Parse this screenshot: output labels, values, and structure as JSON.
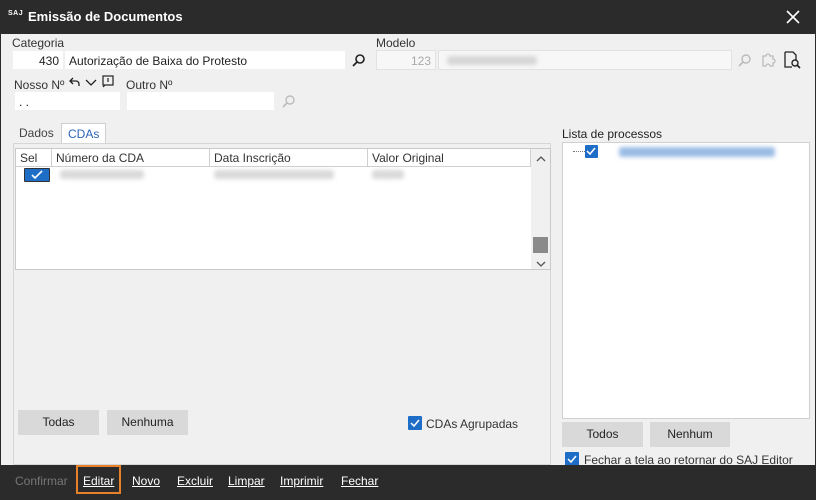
{
  "window": {
    "logo_text": "SAJ",
    "title": "Emissão de Documentos"
  },
  "header": {
    "categoria_label": "Categoria",
    "categoria_code": "430",
    "categoria_desc": "Autorização de Baixa do Protesto",
    "modelo_label": "Modelo",
    "modelo_code": "123",
    "nosso_no_label": "Nosso Nº",
    "nosso_no_value": " .  .",
    "outro_no_label": "Outro Nº",
    "outro_no_value": ""
  },
  "tabs": [
    {
      "label": "Dados",
      "active": false
    },
    {
      "label": "CDAs",
      "active": true
    }
  ],
  "grid": {
    "columns": [
      "Sel",
      "Número da CDA",
      "Data Inscrição",
      "Valor Original"
    ],
    "rows": [
      {
        "selected": true
      }
    ]
  },
  "left_buttons": {
    "todas": "Todas",
    "nenhuma": "Nenhuma",
    "cdas_agrupadas": "CDAs Agrupadas"
  },
  "processes": {
    "label": "Lista de processos",
    "todos": "Todos",
    "nenhum": "Nenhum",
    "fechar_label": "Fechar a tela ao retornar do SAJ Editor"
  },
  "footer": {
    "confirmar": "Confirmar",
    "editar": "Editar",
    "novo": "Novo",
    "excluir": "Excluir",
    "limpar": "Limpar",
    "imprimir": "Imprimir",
    "fechar": "Fechar"
  },
  "colors": {
    "titlebar": "#2b2b2b",
    "accent": "#1e6ec8",
    "focus": "#e8822a"
  }
}
